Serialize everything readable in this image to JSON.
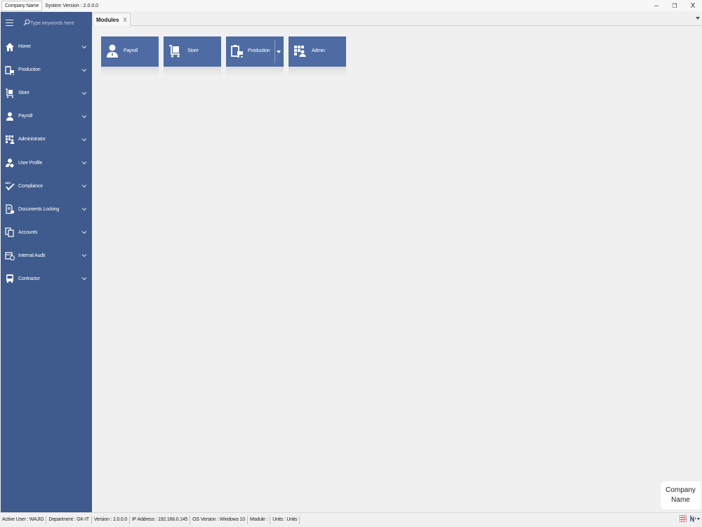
{
  "titlebar": {
    "company": "Company Name",
    "system_version": "System Version : 2.0.0.0",
    "controls": {
      "minimize": "–",
      "restore": "❐",
      "close": "X"
    }
  },
  "sidebar": {
    "search_placeholder": "Type keywords here",
    "items": [
      {
        "label": "Home",
        "icon": "home-icon"
      },
      {
        "label": "Production",
        "icon": "clipboard-cart-icon"
      },
      {
        "label": "Store",
        "icon": "cart-icon"
      },
      {
        "label": "Payroll",
        "icon": "user-icon"
      },
      {
        "label": "Administrator",
        "icon": "grid-user-icon"
      },
      {
        "label": "User Profile",
        "icon": "user-edit-icon"
      },
      {
        "label": "Compliance",
        "icon": "abc-check-icon"
      },
      {
        "label": "Documents Locking",
        "icon": "document-lock-icon"
      },
      {
        "label": "Accounts",
        "icon": "copy-documents-icon"
      },
      {
        "label": "Internal Audit",
        "icon": "audit-clock-icon"
      },
      {
        "label": "Contractor",
        "icon": "bus-icon"
      }
    ]
  },
  "tabs": [
    {
      "label": "Modules",
      "close": "X"
    }
  ],
  "tiles": [
    {
      "label": "Payroll",
      "icon": "user-icon"
    },
    {
      "label": "Store",
      "icon": "cart-icon"
    },
    {
      "label": "Production",
      "icon": "clipboard-cart-icon",
      "has_dropdown": true
    },
    {
      "label": "Admin",
      "icon": "grid-user-icon"
    }
  ],
  "brand_card": {
    "line1": "Company",
    "line2": "Name"
  },
  "statusbar": {
    "active_user": "Active User : WAJID",
    "department": "Department : GK-IT",
    "version": "Version : 2.0.0.0",
    "ip_address": "IP Address : 192.168.0.145",
    "os_version": "OS Version : Windows 10",
    "module": "Module :",
    "units": "Units : Units"
  },
  "colors": {
    "sidebar": "#3f5a8c",
    "tile": "#4e6ca3",
    "background": "#f0f0f0"
  }
}
